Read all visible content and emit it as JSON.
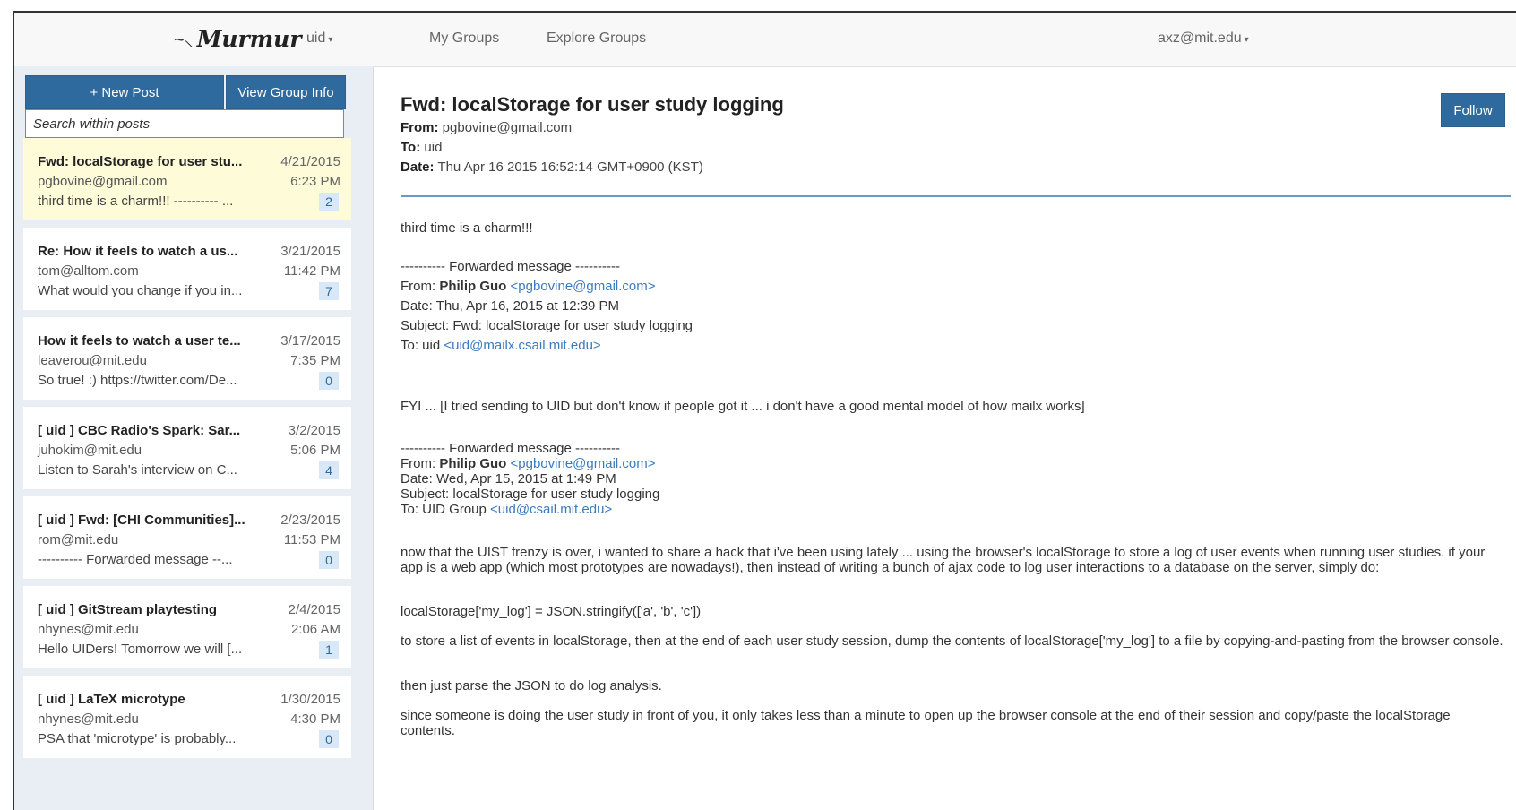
{
  "nav": {
    "logo": "Murmur",
    "group_selector": "uid",
    "my_groups": "My Groups",
    "explore_groups": "Explore Groups",
    "user_menu": "axz@mit.edu"
  },
  "sidebar": {
    "new_post": "+ New Post",
    "view_group_info": "View Group Info",
    "search_placeholder": "Search within posts",
    "posts": [
      {
        "title": "Fwd: localStorage for user stu...",
        "sender": "pgbovine@gmail.com",
        "snippet": "third time is a charm!!! ---------- ...",
        "date": "4/21/2015",
        "time": "6:23 PM",
        "count": "2"
      },
      {
        "title": "Re: How it feels to watch a us...",
        "sender": "tom@alltom.com",
        "snippet": "What would you change if you in...",
        "date": "3/21/2015",
        "time": "11:42 PM",
        "count": "7"
      },
      {
        "title": "How it feels to watch a user te...",
        "sender": "leaverou@mit.edu",
        "snippet": "So true! :) https://twitter.com/De...",
        "date": "3/17/2015",
        "time": "7:35 PM",
        "count": "0"
      },
      {
        "title": "[ uid ] CBC Radio's Spark: Sar...",
        "sender": "juhokim@mit.edu",
        "snippet": "Listen to Sarah's interview on C...",
        "date": "3/2/2015",
        "time": "5:06 PM",
        "count": "4"
      },
      {
        "title": "[ uid ] Fwd: [CHI Communities]...",
        "sender": "rom@mit.edu",
        "snippet": "---------- Forwarded message --...",
        "date": "2/23/2015",
        "time": "11:53 PM",
        "count": "0"
      },
      {
        "title": "[ uid ] GitStream playtesting",
        "sender": "nhynes@mit.edu",
        "snippet": "Hello UIDers! Tomorrow we will [...",
        "date": "2/4/2015",
        "time": "2:06 AM",
        "count": "1"
      },
      {
        "title": "[ uid ] LaTeX microtype",
        "sender": "nhynes@mit.edu",
        "snippet": "PSA that 'microtype' is probably...",
        "date": "1/30/2015",
        "time": "4:30 PM",
        "count": "0"
      }
    ]
  },
  "main": {
    "follow": "Follow",
    "title": "Fwd: localStorage for user study logging",
    "from_label": "From:",
    "from": "pgbovine@gmail.com",
    "to_label": "To:",
    "to": "uid",
    "date_label": "Date:",
    "date": "Thu Apr 16 2015 16:52:14 GMT+0900 (KST)",
    "intro": "third time is a charm!!!",
    "fwd1": {
      "header": "---------- Forwarded message ----------",
      "from_label": "From:",
      "from_name": "Philip Guo",
      "from_email": "<pgbovine@gmail.com>",
      "date": "Date: Thu, Apr 16, 2015 at 12:39 PM",
      "subject": "Subject: Fwd: localStorage for user study logging",
      "to_label": "To: uid",
      "to_email": "<uid@mailx.csail.mit.edu>"
    },
    "fyi": "FYI ... [I tried sending to UID but don't know if people got it ... i don't have a good mental model of how mailx works]",
    "fwd2": {
      "header": "---------- Forwarded message ----------",
      "from_label": "From:",
      "from_name": "Philip Guo",
      "from_email": "<pgbovine@gmail.com>",
      "date": "Date: Wed, Apr 15, 2015 at 1:49 PM",
      "subject": "Subject: localStorage for user study logging",
      "to_label": "To: UID Group",
      "to_email": "<uid@csail.mit.edu>"
    },
    "para1": "now that the UIST frenzy is over, i wanted to share a hack that i've been using lately ... using the browser's localStorage to store a log of user events when running user studies. if your app is a web app (which most prototypes are nowadays!), then instead of writing a bunch of ajax code to log user interactions to a database on the server, simply do:",
    "code": "localStorage['my_log'] = JSON.stringify(['a', 'b', 'c'])",
    "para2": "to store a list of events in localStorage, then at the end of each user study session, dump the contents of localStorage['my_log'] to a file by copying-and-pasting from the browser console.",
    "para3": "then just parse the JSON to do log analysis.",
    "para4": "since someone is doing the user study in front of you, it only takes less than a minute to open up the browser console at the end of their session and copy/paste the localStorage contents."
  }
}
